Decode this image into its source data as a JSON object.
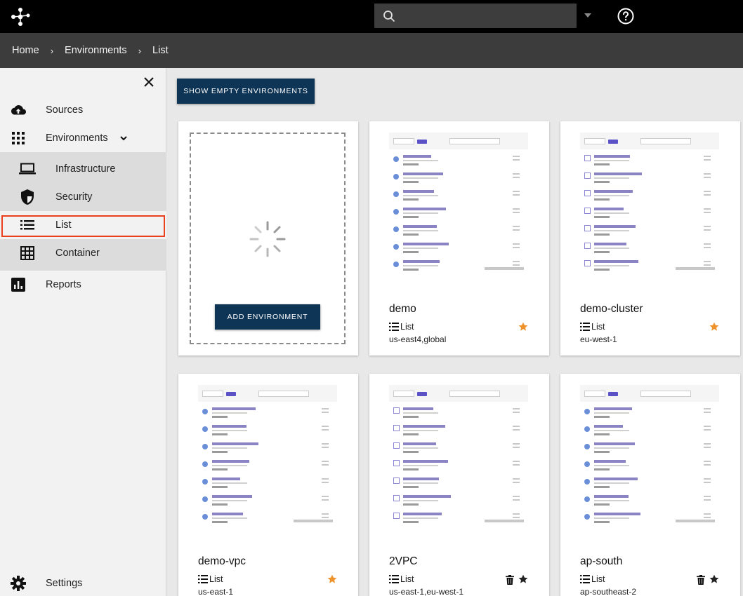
{
  "topbar": {
    "logo": "network-logo-icon",
    "search_placeholder": "",
    "help": "help-icon"
  },
  "breadcrumb": [
    "Home",
    "Environments",
    "List"
  ],
  "sidebar": {
    "items": [
      {
        "label": "Sources",
        "icon": "cloud-upload-icon"
      },
      {
        "label": "Environments",
        "icon": "apps-grid-icon"
      },
      {
        "label": "Reports",
        "icon": "bar-chart-icon"
      },
      {
        "label": "Settings",
        "icon": "gear-icon"
      }
    ],
    "sub_items": [
      {
        "label": "Infrastructure",
        "icon": "laptop-icon"
      },
      {
        "label": "Security",
        "icon": "shield-icon"
      },
      {
        "label": "List",
        "icon": "list-icon"
      },
      {
        "label": "Container",
        "icon": "grid-table-icon"
      }
    ]
  },
  "main": {
    "show_empty_label": "SHOW EMPTY ENVIRONMENTS",
    "add_label": "ADD ENVIRONMENT",
    "cards": [
      {
        "name": "demo",
        "kind": "List",
        "region": "us-east4,global",
        "starred": true,
        "starColor": "#f0922b"
      },
      {
        "name": "demo-cluster",
        "kind": "List",
        "region": "eu-west-1",
        "starred": true,
        "starColor": "#f0922b"
      },
      {
        "name": "demo-vpc",
        "kind": "List",
        "region": "us-east-1",
        "starred": true,
        "starColor": "#f0922b"
      },
      {
        "name": "2VPC",
        "kind": "List",
        "region": "us-east-1,eu-west-1",
        "starred": false,
        "starColor": "#222222"
      },
      {
        "name": "ap-south",
        "kind": "List",
        "region": "ap-southeast-2",
        "starred": false,
        "starColor": "#222222"
      }
    ]
  },
  "colors": {
    "primary_button": "#0e3456",
    "highlight_outline": "#e8401c",
    "star_favorite": "#f0922b"
  }
}
